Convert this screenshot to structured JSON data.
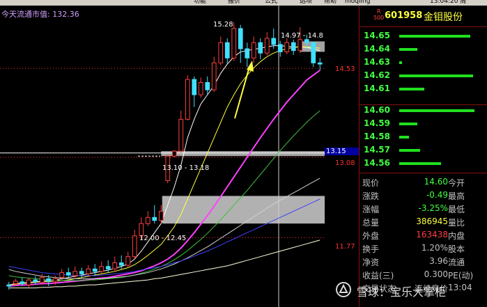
{
  "menu": {
    "items": [
      "功能",
      "报价",
      "公式",
      "选项",
      "帮助",
      "moqling"
    ],
    "clock": "13:04:20 周"
  },
  "chart": {
    "market_cap_label": "今天流通市值: 132.36",
    "high_label": "15.28",
    "range_label_top": "14.97 - 14.8",
    "range_label_mid": "13.10 - 13.18",
    "range_label_low": "12.00 - 12.45",
    "price_scale": [
      {
        "label": "14.53",
        "color": "#ff3030"
      },
      {
        "label": "13.15",
        "color": "#ffffff"
      },
      {
        "label": "13.08",
        "color": "#ff3030"
      },
      {
        "label": "11.77",
        "color": "#ff3030"
      }
    ]
  },
  "chart_data": {
    "type": "candlestick",
    "ylim": [
      10.9,
      15.35
    ],
    "candles": [
      {
        "o": 11.0,
        "c": 10.98,
        "h": 11.05,
        "l": 10.92
      },
      {
        "o": 11.02,
        "c": 11.06,
        "h": 11.1,
        "l": 10.98
      },
      {
        "o": 11.05,
        "c": 11.02,
        "h": 11.12,
        "l": 10.98
      },
      {
        "o": 11.0,
        "c": 11.08,
        "h": 11.12,
        "l": 10.96
      },
      {
        "o": 11.08,
        "c": 11.05,
        "h": 11.14,
        "l": 11.0
      },
      {
        "o": 11.04,
        "c": 11.12,
        "h": 11.18,
        "l": 11.0
      },
      {
        "o": 11.1,
        "c": 11.06,
        "h": 11.16,
        "l": 10.98
      },
      {
        "o": 11.06,
        "c": 11.1,
        "h": 11.15,
        "l": 11.0
      },
      {
        "o": 11.12,
        "c": 11.2,
        "h": 11.26,
        "l": 11.08
      },
      {
        "o": 11.2,
        "c": 11.16,
        "h": 11.28,
        "l": 11.1
      },
      {
        "o": 11.15,
        "c": 11.22,
        "h": 11.3,
        "l": 11.1
      },
      {
        "o": 11.22,
        "c": 11.18,
        "h": 11.28,
        "l": 11.12
      },
      {
        "o": 11.18,
        "c": 11.26,
        "h": 11.32,
        "l": 11.14
      },
      {
        "o": 11.26,
        "c": 11.22,
        "h": 11.34,
        "l": 11.16
      },
      {
        "o": 11.22,
        "c": 11.3,
        "h": 11.38,
        "l": 11.18
      },
      {
        "o": 11.3,
        "c": 11.26,
        "h": 11.4,
        "l": 11.2
      },
      {
        "o": 11.26,
        "c": 11.36,
        "h": 11.46,
        "l": 11.22
      },
      {
        "o": 11.36,
        "c": 11.32,
        "h": 11.48,
        "l": 11.26
      },
      {
        "o": 11.32,
        "c": 11.46,
        "h": 11.54,
        "l": 11.28
      },
      {
        "o": 11.46,
        "c": 11.8,
        "h": 11.9,
        "l": 11.42
      },
      {
        "o": 11.8,
        "c": 12.0,
        "h": 12.1,
        "l": 11.74
      },
      {
        "o": 12.0,
        "c": 12.1,
        "h": 12.2,
        "l": 11.96
      },
      {
        "o": 12.1,
        "c": 12.05,
        "h": 12.3,
        "l": 12.0
      },
      {
        "o": 12.05,
        "c": 12.2,
        "h": 12.3,
        "l": 12.0
      },
      {
        "o": 12.7,
        "c": 13.1,
        "h": 13.12,
        "l": 12.66
      },
      {
        "o": 13.1,
        "c": 13.18,
        "h": 13.2,
        "l": 13.08
      },
      {
        "o": 13.18,
        "c": 13.7,
        "h": 13.84,
        "l": 13.15
      },
      {
        "o": 13.7,
        "c": 14.35,
        "h": 14.42,
        "l": 13.68
      },
      {
        "o": 14.35,
        "c": 14.1,
        "h": 14.4,
        "l": 13.9
      },
      {
        "o": 14.1,
        "c": 14.3,
        "h": 14.38,
        "l": 14.05
      },
      {
        "o": 14.3,
        "c": 14.18,
        "h": 14.4,
        "l": 14.1
      },
      {
        "o": 14.18,
        "c": 14.62,
        "h": 14.72,
        "l": 14.15
      },
      {
        "o": 14.62,
        "c": 14.95,
        "h": 15.05,
        "l": 14.58
      },
      {
        "o": 14.95,
        "c": 14.7,
        "h": 15.02,
        "l": 14.6
      },
      {
        "o": 14.7,
        "c": 15.18,
        "h": 15.28,
        "l": 14.65
      },
      {
        "o": 15.18,
        "c": 14.85,
        "h": 15.24,
        "l": 14.62
      },
      {
        "o": 14.85,
        "c": 14.7,
        "h": 14.95,
        "l": 14.55
      },
      {
        "o": 14.7,
        "c": 14.95,
        "h": 15.05,
        "l": 14.62
      },
      {
        "o": 14.95,
        "c": 14.78,
        "h": 15.02,
        "l": 14.68
      },
      {
        "o": 14.78,
        "c": 15.02,
        "h": 15.12,
        "l": 14.74
      },
      {
        "o": 15.02,
        "c": 14.92,
        "h": 15.18,
        "l": 14.85
      },
      {
        "o": 14.92,
        "c": 14.8,
        "h": 14.98,
        "l": 14.72
      },
      {
        "o": 14.8,
        "c": 14.95,
        "h": 15.02,
        "l": 14.76
      },
      {
        "o": 14.95,
        "c": 14.82,
        "h": 15.0,
        "l": 14.75
      },
      {
        "o": 14.82,
        "c": 15.0,
        "h": 15.2,
        "l": 14.78
      },
      {
        "o": 15.0,
        "c": 14.95,
        "h": 15.08,
        "l": 14.85
      },
      {
        "o": 14.95,
        "c": 14.62,
        "h": 14.97,
        "l": 14.55
      },
      {
        "o": 14.62,
        "c": 14.6,
        "h": 14.7,
        "l": 14.5
      }
    ],
    "ma_lines": [
      {
        "name": "MA5",
        "color": "#ffffff",
        "values": [
          11.0,
          11.02,
          11.03,
          11.04,
          11.05,
          11.06,
          11.07,
          11.08,
          11.1,
          11.12,
          11.14,
          11.16,
          11.18,
          11.2,
          11.22,
          11.24,
          11.27,
          11.3,
          11.34,
          11.42,
          11.55,
          11.7,
          11.85,
          12.0,
          12.3,
          12.6,
          12.95,
          13.4,
          13.7,
          13.95,
          14.1,
          14.25,
          14.45,
          14.6,
          14.72,
          14.8,
          14.82,
          14.84,
          14.86,
          14.88,
          14.9,
          14.9,
          14.89,
          14.88,
          14.88,
          14.87,
          14.85,
          14.82
        ]
      },
      {
        "name": "MA10",
        "color": "#ffff40",
        "values": [
          11.0,
          11.01,
          11.02,
          11.03,
          11.04,
          11.05,
          11.05,
          11.06,
          11.07,
          11.08,
          11.1,
          11.12,
          11.14,
          11.16,
          11.18,
          11.2,
          11.22,
          11.25,
          11.28,
          11.33,
          11.4,
          11.48,
          11.57,
          11.66,
          11.8,
          11.95,
          12.15,
          12.4,
          12.65,
          12.9,
          13.15,
          13.4,
          13.65,
          13.9,
          14.1,
          14.28,
          14.42,
          14.54,
          14.64,
          14.72,
          14.78,
          14.82,
          14.85,
          14.87,
          14.88,
          14.88,
          14.87,
          14.86
        ]
      },
      {
        "name": "MA20",
        "color": "#ff40ff",
        "values": [
          10.98,
          10.99,
          11.0,
          11.0,
          11.01,
          11.02,
          11.02,
          11.03,
          11.04,
          11.05,
          11.06,
          11.07,
          11.08,
          11.1,
          11.11,
          11.12,
          11.14,
          11.16,
          11.18,
          11.2,
          11.23,
          11.27,
          11.31,
          11.36,
          11.42,
          11.5,
          11.6,
          11.72,
          11.85,
          11.99,
          12.13,
          12.28,
          12.44,
          12.6,
          12.76,
          12.92,
          13.08,
          13.24,
          13.4,
          13.55,
          13.7,
          13.84,
          13.98,
          14.1,
          14.22,
          14.34,
          14.42,
          14.5
        ]
      },
      {
        "name": "MA30",
        "color": "#40c040",
        "values": [
          11.15,
          11.13,
          11.12,
          11.11,
          11.1,
          11.09,
          11.08,
          11.08,
          11.07,
          11.07,
          11.07,
          11.07,
          11.08,
          11.08,
          11.09,
          11.1,
          11.11,
          11.12,
          11.14,
          11.16,
          11.19,
          11.22,
          11.26,
          11.3,
          11.35,
          11.41,
          11.48,
          11.56,
          11.65,
          11.74,
          11.84,
          11.95,
          12.06,
          12.18,
          12.3,
          12.42,
          12.54,
          12.67,
          12.8,
          12.93,
          13.06,
          13.19,
          13.31,
          13.43,
          13.54,
          13.65,
          13.75,
          13.84
        ]
      },
      {
        "name": "MA60",
        "color": "#d0d0d0",
        "values": [
          11.25,
          11.22,
          11.2,
          11.18,
          11.16,
          11.14,
          11.13,
          11.12,
          11.11,
          11.1,
          11.1,
          11.1,
          11.1,
          11.1,
          11.1,
          11.11,
          11.12,
          11.13,
          11.14,
          11.16,
          11.18,
          11.2,
          11.23,
          11.26,
          11.3,
          11.34,
          11.39,
          11.44,
          11.5,
          11.56,
          11.62,
          11.69,
          11.76,
          11.83,
          11.9,
          11.97,
          12.04,
          12.11,
          12.18,
          12.25,
          12.32,
          12.38,
          12.44,
          12.5,
          12.56,
          12.62,
          12.68,
          12.74
        ]
      },
      {
        "name": "MA120",
        "color": "#4040ff",
        "values": [
          11.3,
          11.28,
          11.26,
          11.24,
          11.22,
          11.2,
          11.19,
          11.18,
          11.17,
          11.16,
          11.15,
          11.15,
          11.15,
          11.15,
          11.16,
          11.17,
          11.18,
          11.19,
          11.2,
          11.22,
          11.24,
          11.26,
          11.28,
          11.3,
          11.33,
          11.36,
          11.39,
          11.43,
          11.47,
          11.51,
          11.55,
          11.6,
          11.65,
          11.7,
          11.75,
          11.8,
          11.85,
          11.9,
          11.95,
          12.0,
          12.05,
          12.1,
          12.15,
          12.2,
          12.25,
          12.3,
          12.35,
          12.4
        ]
      },
      {
        "name": "MA250",
        "color": "#ffffe0",
        "values": [
          10.95,
          10.95,
          10.95,
          10.95,
          10.95,
          10.96,
          10.96,
          10.97,
          10.97,
          10.98,
          10.98,
          10.99,
          11.0,
          11.0,
          11.01,
          11.02,
          11.03,
          11.04,
          11.05,
          11.06,
          11.07,
          11.08,
          11.1,
          11.11,
          11.13,
          11.15,
          11.17,
          11.19,
          11.21,
          11.23,
          11.25,
          11.27,
          11.29,
          11.31,
          11.34,
          11.37,
          11.4,
          11.43,
          11.46,
          11.49,
          11.52,
          11.55,
          11.58,
          11.61,
          11.64,
          11.67,
          11.7,
          11.73
        ]
      }
    ],
    "zones": [
      {
        "from": 14.8,
        "to": 14.97,
        "color": "#c0c0c0"
      },
      {
        "from": 13.1,
        "to": 13.18,
        "color": "#c0c0c0"
      },
      {
        "from": 12.0,
        "to": 12.45,
        "color": "#d0d0d0"
      }
    ],
    "hlines": [
      {
        "y": 14.53,
        "color": "#ff3030",
        "style": "dotted"
      },
      {
        "y": 13.08,
        "color": "#ff3030",
        "style": "dotted"
      },
      {
        "y": 11.77,
        "color": "#ff3030",
        "style": "dotted"
      },
      {
        "y": 13.15,
        "color": "#ffffff",
        "style": "solid"
      }
    ]
  },
  "stock": {
    "badge_top": "R",
    "badge_bottom": "500",
    "code": "601958",
    "name": "金钼股份"
  },
  "order_book": {
    "asks": [
      {
        "price": "14.65",
        "vol": 0.85
      },
      {
        "price": "14.64",
        "vol": 0.22
      },
      {
        "price": "14.63",
        "vol": 0.03
      },
      {
        "price": "14.62",
        "vol": 0.88
      },
      {
        "price": "14.61",
        "vol": 0.3
      }
    ],
    "bids": [
      {
        "price": "14.60",
        "vol": 0.9
      },
      {
        "price": "14.59",
        "vol": 0.22
      },
      {
        "price": "14.58",
        "vol": 0.12
      },
      {
        "price": "14.57",
        "vol": 0.25
      },
      {
        "price": "14.56",
        "vol": 0.5
      }
    ]
  },
  "quote": [
    {
      "label": "现价",
      "value": "14.60",
      "value_color": "#40ff40",
      "right": "今开"
    },
    {
      "label": "涨跌",
      "value": "-0.49",
      "value_color": "#40ff40",
      "right": "最高"
    },
    {
      "label": "涨幅",
      "value": "-3.25%",
      "value_color": "#40ff40",
      "right": "最低"
    },
    {
      "label": "总量",
      "value": "386945",
      "value_color": "#ffff40",
      "right": "量比"
    },
    {
      "label": "外盘",
      "value": "163438",
      "value_color": "#ff4040",
      "right": "内盘"
    },
    {
      "label": "换手",
      "value": "1.20%",
      "value_color": "#c0c0c0",
      "right": "股本"
    },
    {
      "label": "净资",
      "value": "3.96",
      "value_color": "#c0c0c0",
      "right": "流通"
    },
    {
      "label": "收益(三)",
      "value": "0.300",
      "value_color": "#c0c0c0",
      "right": "PE(动)"
    },
    {
      "label": "交易状态",
      "value": "连续竞价",
      "value_color": "#c0c0c0",
      "right": "13:04"
    }
  ],
  "watermark": {
    "text": "雪球：宝乐大掌柜"
  }
}
